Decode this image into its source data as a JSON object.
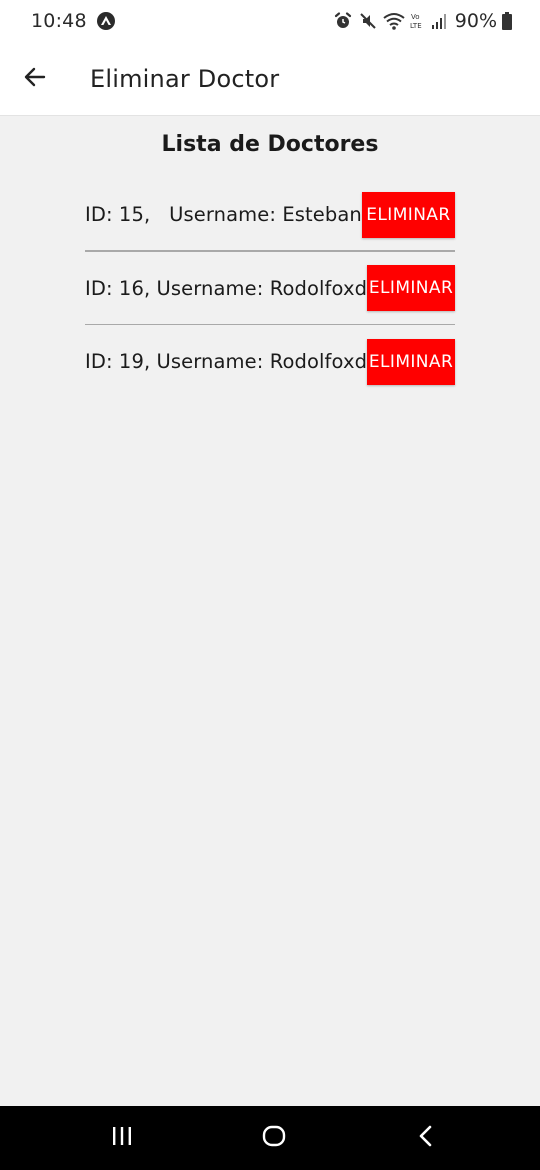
{
  "status_bar": {
    "time": "10:48",
    "battery": "90%",
    "icons": [
      "app-notification-icon",
      "alarm-icon",
      "mute-icon",
      "wifi-icon",
      "volte-icon",
      "signal-icon",
      "battery-icon"
    ]
  },
  "app_bar": {
    "title": "Eliminar Doctor",
    "back_icon": "arrow-left-icon"
  },
  "main": {
    "list_title": "Lista de Doctores",
    "doctors": [
      {
        "label": "ID: 15,   Username: Esteban",
        "button": "ELIMINAR"
      },
      {
        "label": "ID: 16, Username: Rodolfoxd",
        "button": "ELIMINAR"
      },
      {
        "label": "ID: 19, Username: Rodolfoxd",
        "button": "ELIMINAR"
      }
    ]
  },
  "nav_bar": {
    "icons": [
      "recent-apps-icon",
      "home-icon",
      "back-icon"
    ]
  },
  "colors": {
    "delete_button": "#ff0000",
    "background": "#f1f1f1",
    "app_bar": "#ffffff"
  }
}
